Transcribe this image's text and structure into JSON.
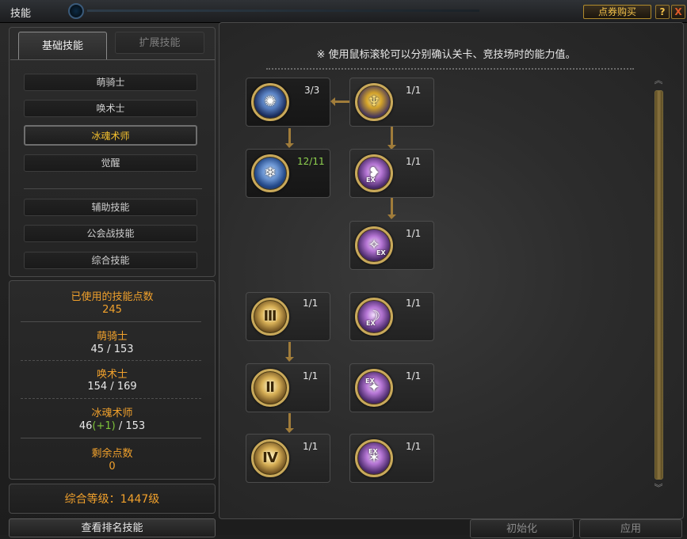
{
  "window": {
    "title": "技能"
  },
  "header": {
    "buy_label": "点券购买",
    "help_label": "?",
    "close_label": "X"
  },
  "tabs": {
    "basic": "基础技能",
    "extended": "扩展技能"
  },
  "class_list": [
    "萌骑士",
    "唤术士",
    "冰魂术师",
    "觉醒"
  ],
  "category_list": [
    "辅助技能",
    "公会战技能",
    "综合技能"
  ],
  "stats": {
    "used_label": "已使用的技能点数",
    "used_value": "245",
    "classes": [
      {
        "name": "萌骑士",
        "used": "45",
        "total": "153",
        "bonus": ""
      },
      {
        "name": "唤术士",
        "used": "154",
        "total": "169",
        "bonus": ""
      },
      {
        "name": "冰魂术师",
        "used": "46",
        "total": "153",
        "bonus": "(+1)"
      }
    ],
    "remain_label": "剩余点数",
    "remain_value": "0"
  },
  "overall_level": "综合等级：1447级",
  "rank_button": "查看排名技能",
  "notice": "※ 使用鼠标滚轮可以分别确认关卡、竞技场时的能力值。",
  "skills": [
    {
      "icon": "ice-vortex-icon",
      "level": "3/3"
    },
    {
      "icon": "golden-trident-icon",
      "level": "1/1"
    },
    {
      "icon": "ice-shard-icon",
      "level": "12/11"
    },
    {
      "icon": "ex-arcane-wing-icon",
      "level": "1/1"
    },
    {
      "icon": "ex-arcane-spire-icon",
      "level": "1/1"
    },
    {
      "icon": "scroll-mastery-icon",
      "level": "1/1"
    },
    {
      "icon": "ex-arcane-arc-icon",
      "level": "1/1"
    },
    {
      "icon": "scroll-mastery-icon",
      "level": "1/1"
    },
    {
      "icon": "ex-arcane-beast-icon",
      "level": "1/1"
    },
    {
      "icon": "scroll-mastery-icon",
      "level": "1/1"
    },
    {
      "icon": "ex-arcane-sigil-icon",
      "level": "1/1"
    }
  ],
  "footer": {
    "init_label": "初始化",
    "apply_label": "应用"
  },
  "colors": {
    "accent": "#f4c02e",
    "stat_label": "#f1a12c",
    "over_level": "#8fd14f"
  }
}
